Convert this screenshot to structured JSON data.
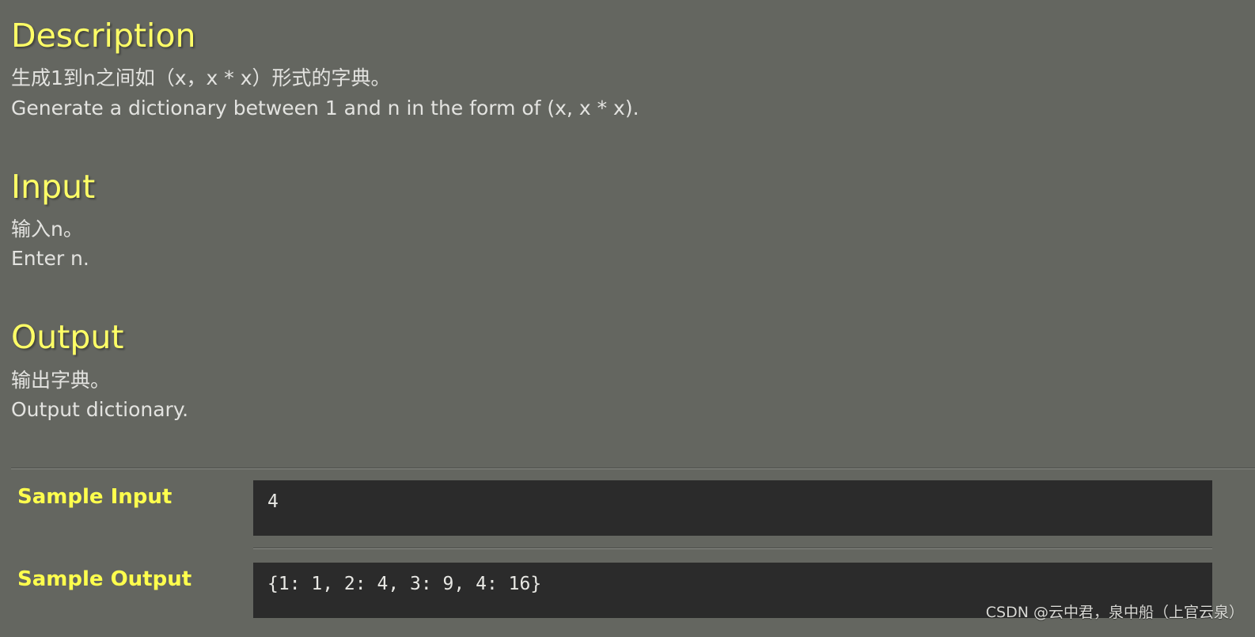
{
  "background_color": "#646660",
  "heading_color": "#ffff66",
  "body_text_color": "#e3e3e0",
  "code_background_color": "#2b2b2b",
  "code_text_color": "#e8e8e4",
  "sample_label_color": "#ffff4d",
  "sections": {
    "description": {
      "heading": "Description",
      "line_cn": "生成1到n之间如（x，x * x）形式的字典。",
      "line_en": "Generate a dictionary between 1 and n in the form of (x, x * x)."
    },
    "input": {
      "heading": "Input",
      "line_cn": "输入n。",
      "line_en": "Enter n."
    },
    "output": {
      "heading": "Output",
      "line_cn": "输出字典。",
      "line_en": "Output dictionary."
    }
  },
  "samples": {
    "input": {
      "label": "Sample Input",
      "code": "4"
    },
    "output": {
      "label": "Sample Output",
      "code": "{1: 1, 2: 4, 3: 9, 4: 16}"
    }
  },
  "watermark": "CSDN @云中君，泉中船（上官云泉）"
}
